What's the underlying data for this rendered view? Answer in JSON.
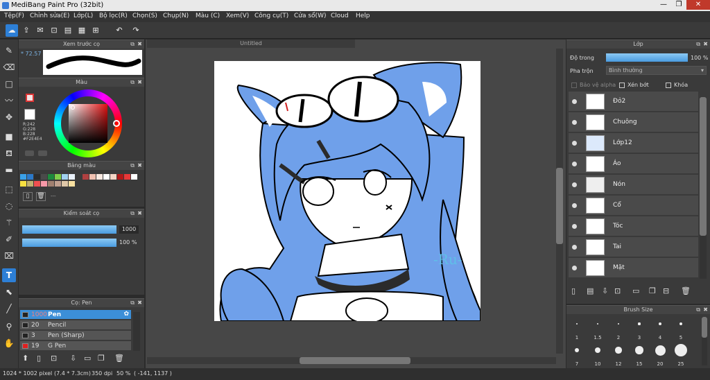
{
  "window": {
    "title": "MediBang Paint Pro (32bit)"
  },
  "menu": [
    "Tệp(F)",
    "Chỉnh sửa(E)",
    "Lớp(L)",
    "Bộ lọc(R)",
    "Chọn(S)",
    "Chụp(N)",
    "Màu (C)",
    "Xem(V)",
    "Công cụ(T)",
    "Cửa sổ(W)",
    "Cloud",
    "Help"
  ],
  "brush_preview": {
    "title": "Xem trước cọ",
    "size": "* 72.57"
  },
  "color": {
    "title": "Màu",
    "r": "R:242",
    "g": "G:228",
    "b": "B:228",
    "hex": "#F2E4E4",
    "primary": "#f2e4e4",
    "secondary": "#f07020"
  },
  "palette": {
    "title": "Bảng màu",
    "colors": [
      "#3aa0e8",
      "#2b78c8",
      "#2c2c2c",
      "#4a4a4a",
      "#1d8a3c",
      "#7fd04a",
      "#a0d0f0",
      "#e8f0f8",
      "#3a3a3a",
      "#b04040",
      "#f0c0b0",
      "#f8e8e0",
      "#ffffff",
      "#f4d4c4",
      "#b01818",
      "#e83838",
      "#ffffff",
      "#f8e040",
      "#c0b070",
      "#f05050",
      "#f898a8",
      "#a08070",
      "#c0a090",
      "#e0c8a8",
      "#f8e0a0"
    ],
    "extra": "---"
  },
  "brush_control": {
    "title": "Kiểm soát cọ",
    "size_value": "1000",
    "opacity_value": "100 %",
    "size_fill": 1.0,
    "opacity_fill": 1.0
  },
  "brushes": {
    "title": "Cọ: Pen",
    "items": [
      {
        "size": "1000",
        "name": "Pen",
        "selected": true
      },
      {
        "size": "20",
        "name": "Pencil"
      },
      {
        "size": "3",
        "name": "Pen (Sharp)"
      },
      {
        "size": "19",
        "name": "G Pen"
      }
    ]
  },
  "canvas": {
    "tab": "Untitled",
    "signature": "-Ru-"
  },
  "layers": {
    "title": "Lớp",
    "opacity_label": "Độ trong",
    "opacity_value": "100 %",
    "opacity_fill": 1.0,
    "blend_label": "Pha trộn",
    "blend_value": "Bình thường",
    "protect_alpha": "Bảo vệ alpha",
    "clipping": "Xén bớt",
    "lock": "Khóa",
    "items": [
      "Đỏ2",
      "Chuông",
      "Lớp12",
      "Áo",
      "Nón",
      "Cổ",
      "Tóc",
      "Tai",
      "Mặt"
    ]
  },
  "brush_size": {
    "title": "Brush Size",
    "values": [
      "1",
      "1.5",
      "2",
      "3",
      "4",
      "5",
      "7",
      "10",
      "12",
      "15",
      "20",
      "25"
    ]
  },
  "status": {
    "size": "1024 * 1002 pixel",
    "cm": "(7.4 * 7.3cm)",
    "dpi": "350 dpi",
    "zoom": "50 %",
    "coords": "( -141, 1137 )"
  }
}
